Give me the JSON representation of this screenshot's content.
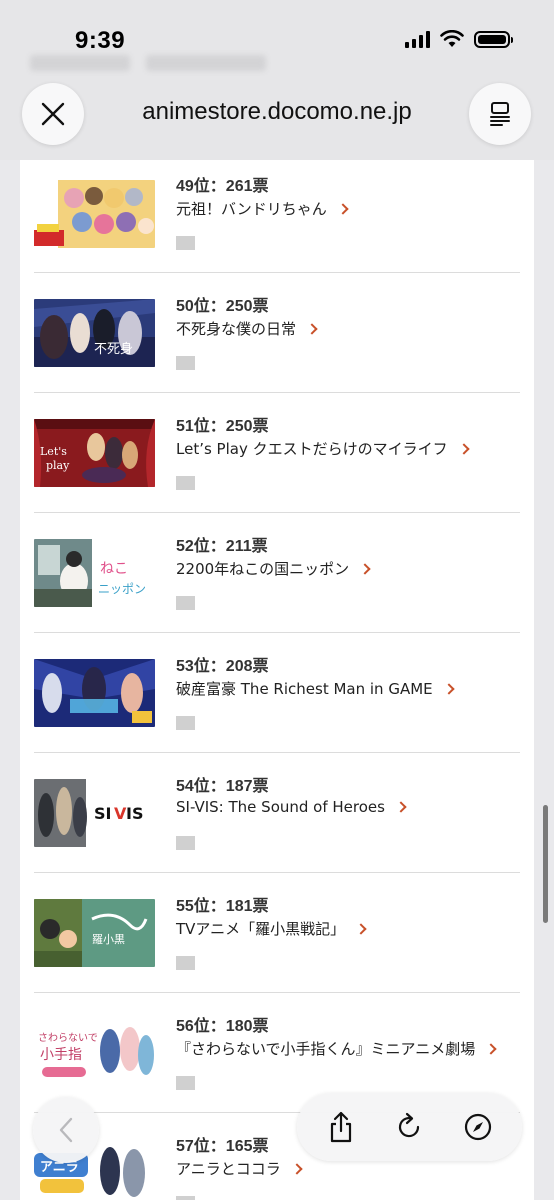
{
  "status_bar": {
    "time": "9:39"
  },
  "browser": {
    "url": "animestore.docomo.ne.jp"
  },
  "ranking": [
    {
      "rank": "49位：261票",
      "title": "元祖！バンドリちゃん"
    },
    {
      "rank": "50位：250票",
      "title": "不死身な僕の日常"
    },
    {
      "rank": "51位：250票",
      "title": "Let’s Play クエストだらけのマイライフ"
    },
    {
      "rank": "52位：211票",
      "title": "2200年ねこの国ニッポン"
    },
    {
      "rank": "53位：208票",
      "title": "破産富豪 The Richest Man in GAME"
    },
    {
      "rank": "54位：187票",
      "title": "SI-VIS: The Sound of Heroes"
    },
    {
      "rank": "55位：181票",
      "title": "TVアニメ「羅小黒戦記」"
    },
    {
      "rank": "56位：180票",
      "title": "『さわらないで小手指くん』ミニアニメ劇場"
    },
    {
      "rank": "57位：165票",
      "title": "アニラとココラ"
    }
  ],
  "icons": {
    "close": "close-icon",
    "reader": "reader-icon",
    "back": "chevron-left-icon",
    "share": "share-icon",
    "reload": "reload-icon",
    "safari": "compass-icon",
    "chevron": "chevron-right-icon"
  },
  "colors": {
    "accent": "#c8512a"
  }
}
